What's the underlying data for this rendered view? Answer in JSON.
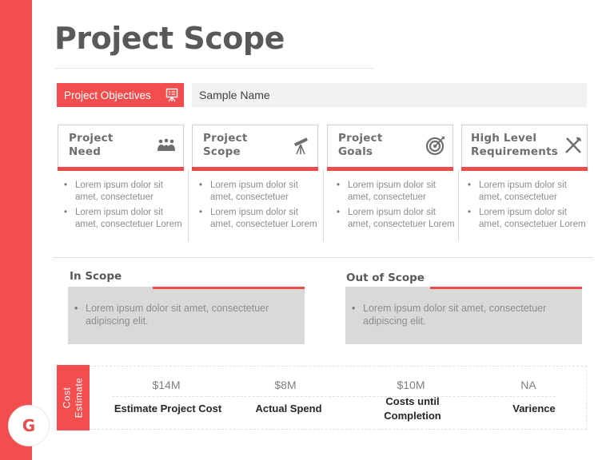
{
  "title": "Project Scope",
  "objectives": {
    "label": "Project Objectives",
    "icon": "presentation-board-icon",
    "value": "Sample Name"
  },
  "cards": [
    {
      "title_line1": "Project",
      "title_line2": "Need",
      "icon": "team-meeting-icon",
      "bullets": [
        "Lorem ipsum dolor sit amet, consectetuer",
        "Lorem ipsum dolor sit amet, consectetuer Lorem"
      ]
    },
    {
      "title_line1": "Project",
      "title_line2": "Scope",
      "icon": "telescope-icon",
      "bullets": [
        "Lorem ipsum dolor sit amet, consectetuer",
        "Lorem ipsum dolor sit amet, consectetuer Lorem"
      ]
    },
    {
      "title_line1": "Project",
      "title_line2": "Goals",
      "icon": "target-icon",
      "bullets": [
        "Lorem ipsum dolor sit amet, consectetuer",
        "Lorem ipsum dolor sit amet, consectetuer Lorem"
      ]
    },
    {
      "title_line1": "High Level",
      "title_line2": "Requirements",
      "icon": "tools-icon",
      "bullets": [
        "Lorem ipsum dolor sit amet, consectetuer",
        "Lorem ipsum dolor sit amet, consectetuer Lorem"
      ]
    }
  ],
  "in_scope": {
    "heading": "In Scope",
    "text": "Lorem ipsum dolor sit amet, consectetuer adipiscing elit."
  },
  "out_scope": {
    "heading": "Out of Scope",
    "text": "Lorem ipsum dolor sit amet, consectetuer adipiscing elit."
  },
  "cost": {
    "label_line1": "Cost",
    "label_line2": "Estimate",
    "items": [
      {
        "value": "$14M",
        "caption": "Estimate Project Cost"
      },
      {
        "value": "$8M",
        "caption": "Actual Spend"
      },
      {
        "value": "$10M",
        "caption": "Costs until Completion"
      },
      {
        "value": "NA",
        "caption": "Varience"
      }
    ]
  },
  "logo_letter": "G",
  "colors": {
    "accent": "#f24e4e",
    "accent_dark": "#e84c4c",
    "panel_gray": "#d9d9d9",
    "light_gray": "#f2f2f2"
  }
}
